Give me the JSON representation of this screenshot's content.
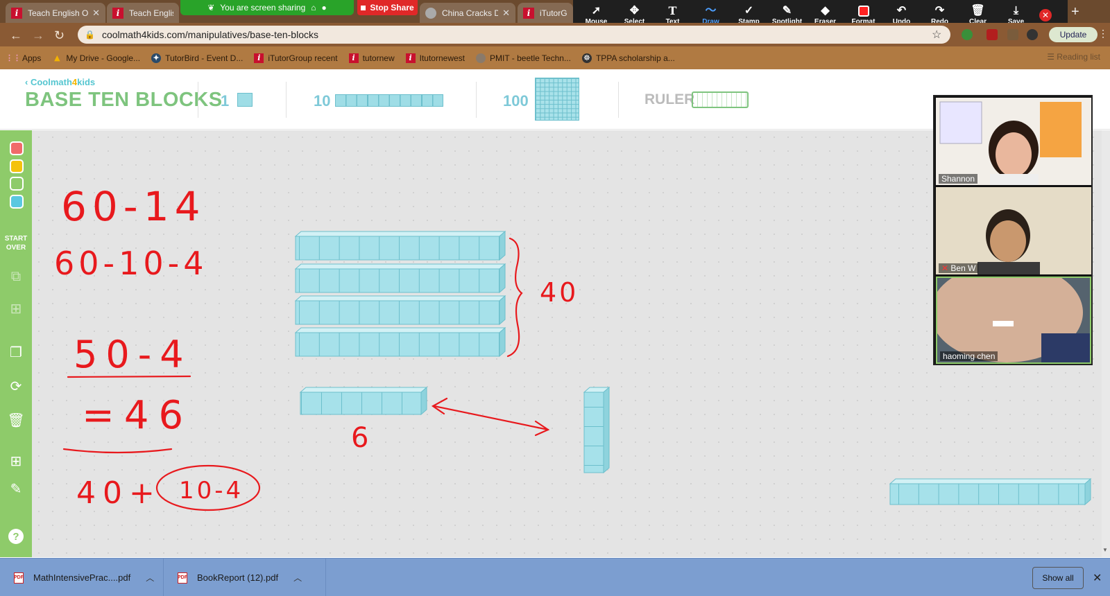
{
  "tabs": [
    {
      "label": "Teach English O"
    },
    {
      "label": "Teach Englisl"
    },
    {
      "label": "China Cracks Do"
    },
    {
      "label": "iTutorG"
    }
  ],
  "share_banner": {
    "text": "You are screen sharing"
  },
  "stop_share": {
    "label": "Stop Share"
  },
  "zoom_toolbar": {
    "tools": [
      {
        "label": "Mouse",
        "icon": "cursor-icon"
      },
      {
        "label": "Select",
        "icon": "move-icon"
      },
      {
        "label": "Text",
        "icon": "text-icon"
      },
      {
        "label": "Draw",
        "icon": "draw-icon"
      },
      {
        "label": "Stamp",
        "icon": "stamp-icon"
      },
      {
        "label": "Spotlight",
        "icon": "spotlight-icon"
      },
      {
        "label": "Eraser",
        "icon": "eraser-icon"
      },
      {
        "label": "Format",
        "icon": "format-icon"
      },
      {
        "label": "Undo",
        "icon": "undo-icon"
      },
      {
        "label": "Redo",
        "icon": "redo-icon"
      },
      {
        "label": "Clear",
        "icon": "trash-icon"
      },
      {
        "label": "Save",
        "icon": "save-icon"
      }
    ],
    "active": "Draw",
    "format_color": "#ff2222"
  },
  "address": {
    "url": "coolmath4kids.com/manipulatives/base-ten-blocks",
    "update_label": "Update"
  },
  "bookmarks": [
    {
      "label": "Apps"
    },
    {
      "label": "My Drive - Google..."
    },
    {
      "label": "TutorBird - Event D..."
    },
    {
      "label": "iTutorGroup recent"
    },
    {
      "label": "tutornew"
    },
    {
      "label": "Itutornewest"
    },
    {
      "label": "PMIT - beetle Techn..."
    },
    {
      "label": "TPPA scholarship a..."
    }
  ],
  "reading_list": "Reading list",
  "header": {
    "logo": {
      "part1": "Coolmath",
      "part2": "4",
      "part3": "kids"
    },
    "title": "BASE TEN BLOCKS",
    "one_label": "1",
    "ten_label": "10",
    "hundred_label": "100",
    "ruler_label": "RULER"
  },
  "left_toolbar": {
    "colors": [
      "#f06a6a",
      "#f4c20d",
      "#8ecb6a",
      "#5ac8e0"
    ],
    "start_over": [
      "START",
      "OVER"
    ],
    "help": "?"
  },
  "participants": [
    {
      "name": "Shannon"
    },
    {
      "name": "Ben W"
    },
    {
      "name": "haoming   chen"
    }
  ],
  "board": {
    "handwriting": {
      "line1": "60-14",
      "line2": "60-10-4",
      "line3": "50-4",
      "line4": "=46",
      "line5": "40+",
      "line5_circled": "10-4",
      "brace_note": "40",
      "rod_note": "6"
    }
  },
  "downloads": [
    {
      "name": "MathIntensivePrac....pdf"
    },
    {
      "name": "BookReport (12).pdf"
    }
  ],
  "show_all": "Show all"
}
